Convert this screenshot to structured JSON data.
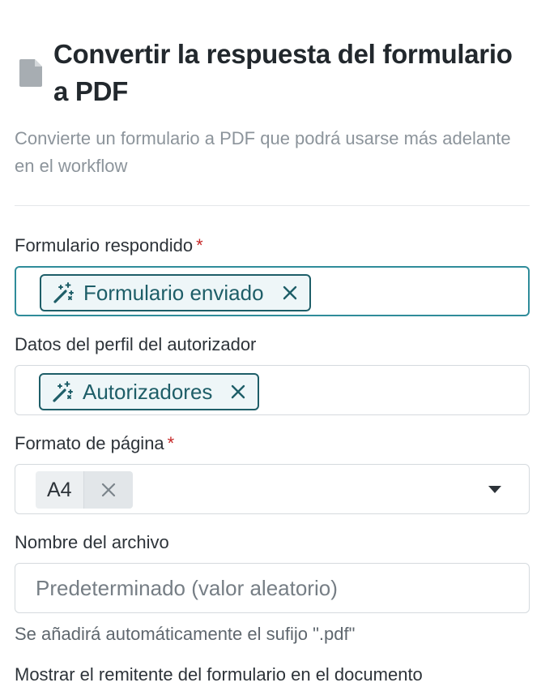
{
  "header": {
    "icon": "document-icon",
    "title": "Convertir la respuesta del formulario a PDF",
    "description": "Convierte un formulario a PDF que podrá usarse más adelante en el workflow"
  },
  "fields": {
    "answered_form": {
      "label": "Formulario respondido",
      "required_mark": "*",
      "chip": {
        "label": "Formulario enviado",
        "icon": "magic-wand-icon",
        "remove_icon": "close-icon"
      }
    },
    "approver_profile": {
      "label": "Datos del perfil del autorizador",
      "chip": {
        "label": "Autorizadores",
        "icon": "magic-wand-icon",
        "remove_icon": "close-icon"
      }
    },
    "page_format": {
      "label": "Formato de página",
      "required_mark": "*",
      "selected_value": "A4",
      "remove_icon": "close-icon",
      "dropdown_icon": "caret-down-icon"
    },
    "file_name": {
      "label": "Nombre del archivo",
      "value": "",
      "placeholder": "Predeterminado (valor aleatorio)",
      "help_text": "Se añadirá automáticamente el sufijo \".pdf\""
    },
    "show_sender": {
      "label": "Mostrar el remitente del formulario en el documento"
    }
  },
  "colors": {
    "accent": "#2f8c9a",
    "chip_text": "#1e5e68",
    "chip_background": "#eef6f8",
    "required": "#c62828",
    "muted_text": "#8c949b"
  }
}
